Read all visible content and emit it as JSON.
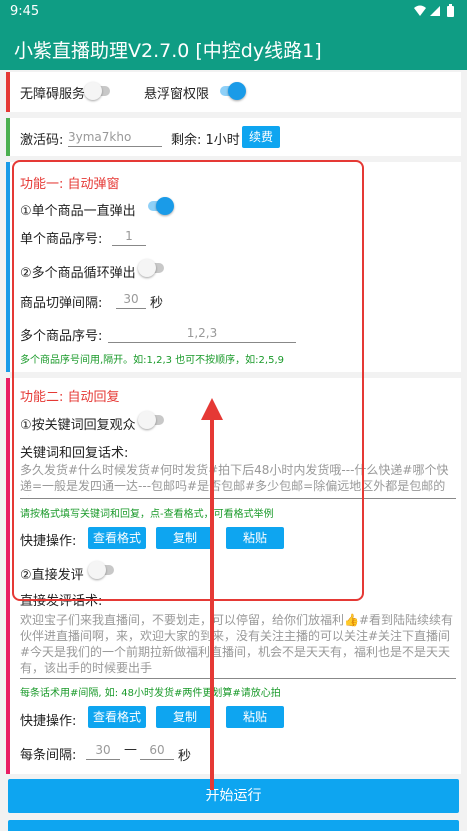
{
  "status": {
    "time": "9:45",
    "icons": "▼◢▮"
  },
  "app": {
    "title": "小紫直播助理V2.7.0 [中控dy线路1]"
  },
  "permissions": {
    "accessibility_label": "无障碍服务",
    "overlay_label": "悬浮窗权限"
  },
  "activation": {
    "code_label": "激活码:",
    "code_placeholder": "3yma7kho",
    "remaining_label": "剩余:",
    "remaining_value": "1小时",
    "renew_label": "续费"
  },
  "feature1": {
    "title": "功能一: 自动弹窗",
    "single_label": "①单个商品一直弹出",
    "single_index_label": "单个商品序号:",
    "single_index_value": "1",
    "multi_label": "②多个商品循环弹出",
    "interval_label": "商品切弹间隔:",
    "interval_value": "30",
    "interval_unit": "秒",
    "multi_index_label": "多个商品序号:",
    "multi_index_value": "1,2,3",
    "hint": "多个商品序号间用,隔开。如:1,2,3 也可不按顺序，如:2,5,9"
  },
  "feature2": {
    "title": "功能二: 自动回复",
    "reply_label": "①按关键词回复观众",
    "keywords_label": "关键词和回复话术:",
    "keywords_text": "多久发货#什么时候发货#何时发货#拍下后48小时内发货哦---什么快递#哪个快递=一般是发四通一达---包邮吗#是否包邮#多少包邮=除偏远地区外都是包邮的哦",
    "keywords_hint": "请按格式填写关键词和回复，点-查看格式，可看格式举例",
    "quick_label": "快捷操作:",
    "view_format": "查看格式",
    "copy": "复制",
    "paste": "粘贴",
    "direct_label": "②直接发评",
    "direct_script_label": "直接发评话术:",
    "direct_text": "欢迎宝子们来我直播间，不要划走，可以停留，给你们放福利👍#看到陆陆续续有伙伴进直播间啊，来，欢迎大家的到来，没有关注主播的可以关注#关注下直播间#今天是我们的一个前期拉新做福利直播间，机会不是天天有，福利也是不是天天有，该出手的时候要出手",
    "direct_hint": "每条话术用#间隔, 如: 48小时发货#两件更划算#请放心拍",
    "quick_label2": "快捷操作:",
    "view_format2": "查看格式",
    "copy2": "复制",
    "paste2": "粘贴",
    "interval_label": "每条间隔:",
    "interval_min": "30",
    "interval_dash": "—",
    "interval_max": "60",
    "interval_unit": "秒"
  },
  "run": {
    "start_label": "开始运行"
  },
  "colors": {
    "teal": "#0f9d84",
    "accent": "#0ea5f0",
    "red": "#e53935",
    "green": "#1a9a2a",
    "pink": "#e91e63",
    "blue": "#1a9be8"
  }
}
